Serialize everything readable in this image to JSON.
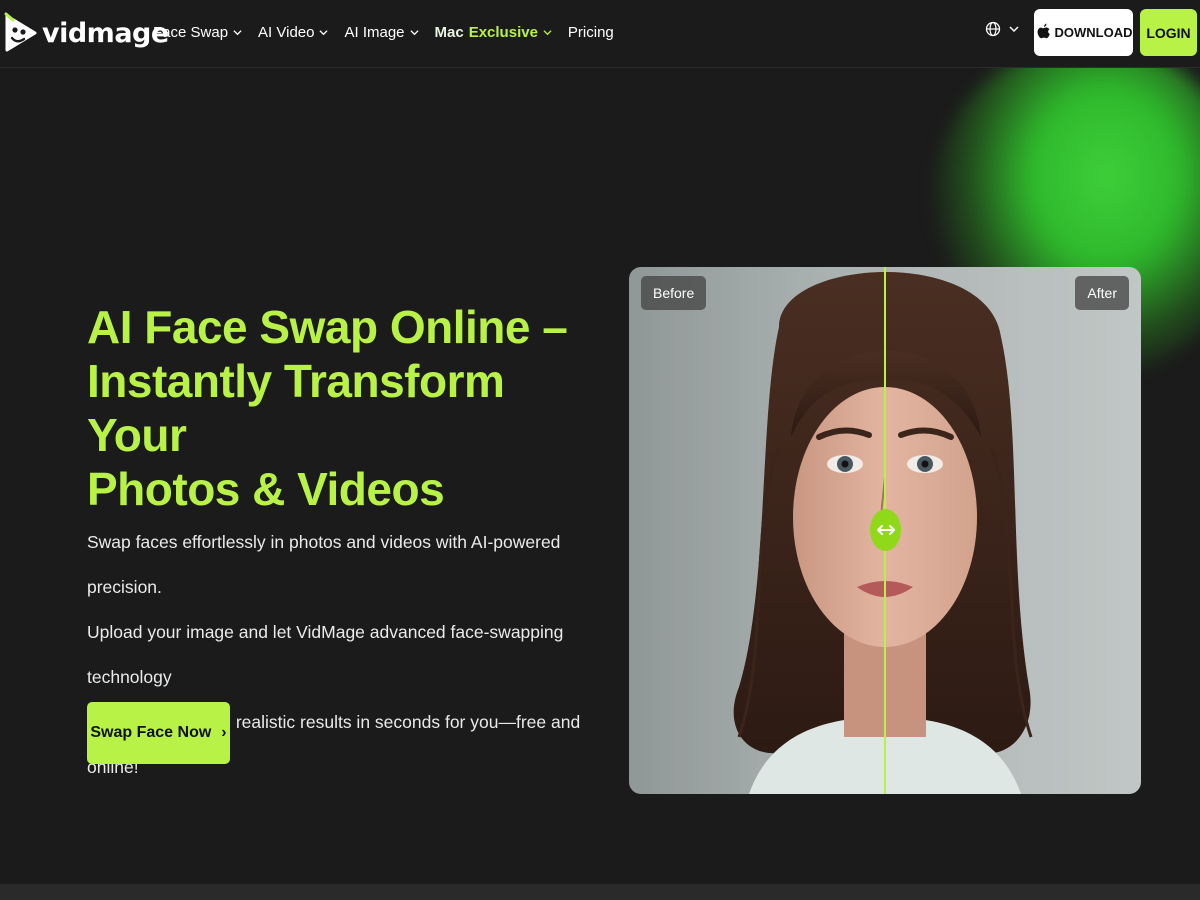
{
  "header": {
    "logo_text": "vidmage",
    "nav": [
      {
        "label": "Face Swap",
        "has_dropdown": true
      },
      {
        "label": "AI Video",
        "has_dropdown": true
      },
      {
        "label": "AI Image",
        "has_dropdown": true
      },
      {
        "label_a": "Mac",
        "label_b": "Exclusive",
        "has_dropdown": true
      },
      {
        "label": "Pricing",
        "has_dropdown": false
      }
    ],
    "language_icon": "globe-icon",
    "download_label": "DOWNLOAD",
    "login_label": "LOGIN"
  },
  "hero": {
    "title_line1": "AI Face Swap Online –",
    "title_line2": "Instantly Transform Your",
    "title_line3": "Photos & Videos",
    "desc_line1": "Swap faces effortlessly in photos and videos with AI-powered precision.",
    "desc_line2": "Upload your image and let VidMage advanced face-swapping technology",
    "desc_line3": "generate hilarious, realistic results in seconds for you—free and online!",
    "cta_label": "Swap Face Now",
    "cta_arrow": "›"
  },
  "compare": {
    "before_label": "Before",
    "after_label": "After",
    "handle_glyph": "↔"
  },
  "colors": {
    "accent": "#b8f246",
    "background": "#1b1b1b"
  }
}
